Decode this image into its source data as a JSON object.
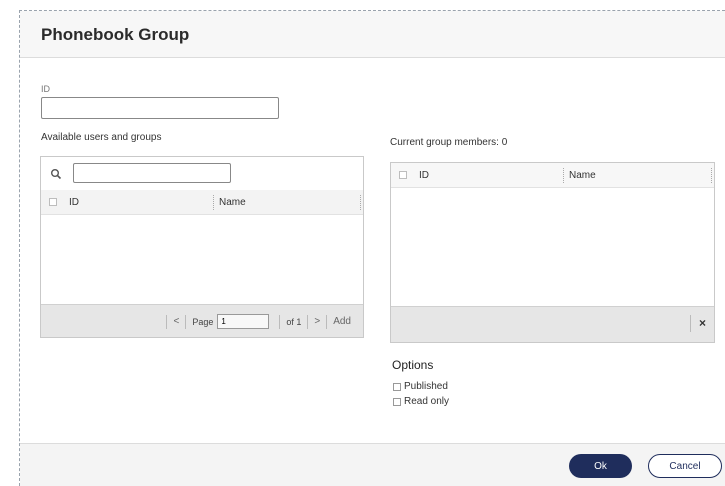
{
  "dialog": {
    "title": "Phonebook Group",
    "id_label": "ID",
    "id_value": "",
    "available_label": "Available users and groups",
    "current_label": "Current group members: 0"
  },
  "available_grid": {
    "search_value": "",
    "columns": [
      "ID",
      "Name"
    ],
    "rows": [],
    "pager": {
      "prev": "<",
      "page_label": "Page",
      "page_value": "1",
      "of_label": "of 1",
      "next": ">",
      "add_label": "Add"
    }
  },
  "members_grid": {
    "columns": [
      "ID",
      "Name"
    ],
    "rows": [],
    "remove_label": "×"
  },
  "options": {
    "title": "Options",
    "published_label": "Published",
    "readonly_label": "Read only"
  },
  "footer": {
    "ok_label": "Ok",
    "cancel_label": "Cancel"
  },
  "colors": {
    "primary": "#1f2d5c",
    "header_bg": "#f7f7f7",
    "footer_bg": "#e6e6e6"
  },
  "icons": {
    "search": "search-icon",
    "remove": "close-icon"
  }
}
